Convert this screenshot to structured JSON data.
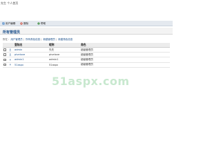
{
  "topbar": {
    "user_text": "先生  个人首页"
  },
  "toolbar": {
    "items": [
      {
        "label": "用户编辑",
        "icon": "edit-icon"
      },
      {
        "label": "删除",
        "icon": "delete-icon"
      },
      {
        "label": "帮助",
        "icon": "help-icon"
      }
    ]
  },
  "panel": {
    "title": "所有管理员"
  },
  "breadcrumb": {
    "prefix": "所在",
    "items": [
      "用户管理员",
      "所有角色信息",
      "新建管理员",
      "新建角色信息"
    ]
  },
  "table": {
    "headers": [
      "登陆名",
      "昵称",
      "角色"
    ],
    "rows": [
      {
        "login": "admin",
        "nickname": "先先",
        "role": "超级管理员"
      },
      {
        "login": "pivelove",
        "nickname": "pivelove",
        "role": "超级管理员"
      },
      {
        "login": "admin1",
        "nickname": "admin1",
        "role": "超级管理员"
      },
      {
        "login": "51aspx",
        "nickname": "51aspx",
        "role": "超级管理员"
      }
    ]
  },
  "watermark": "51aspx.com",
  "colors": {
    "accent": "#1b4f8a",
    "toolbar_bg": "#e4e9ef",
    "watermark": "#c8e8cf"
  }
}
